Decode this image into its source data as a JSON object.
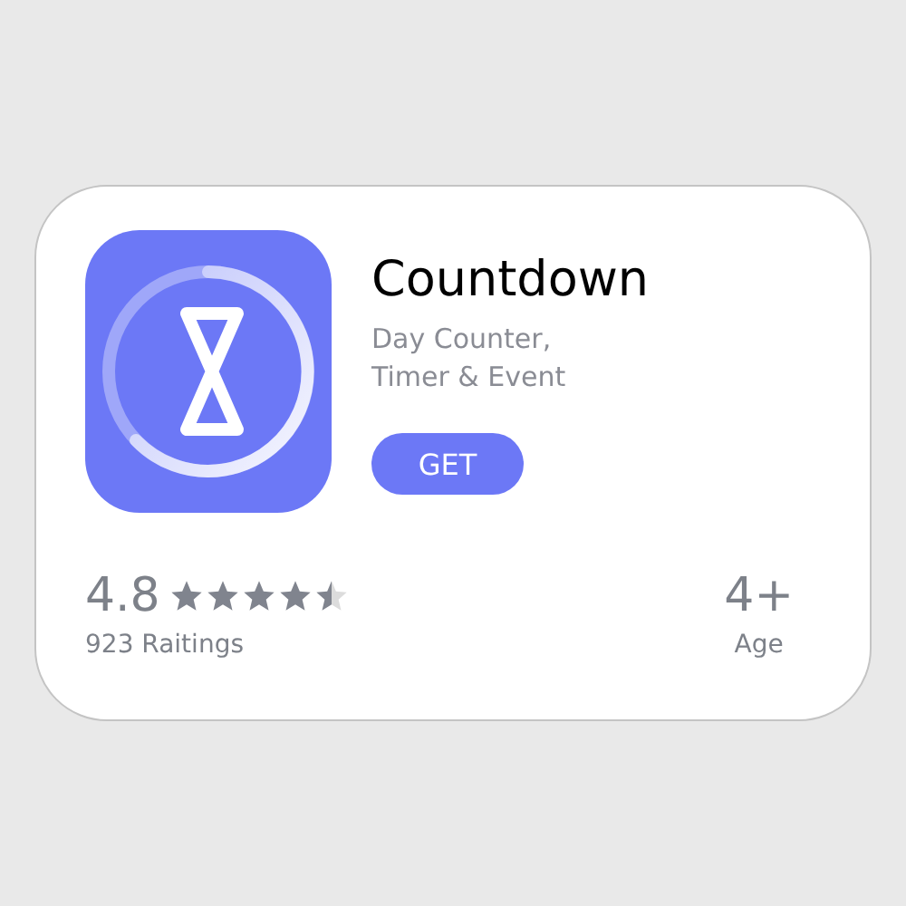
{
  "app": {
    "name": "Countdown",
    "subtitle_lines": [
      "Day Counter,",
      "Timer & Event"
    ],
    "button": "GET"
  },
  "rating": {
    "score": "4.8",
    "stars": 4.5,
    "count": "923 Raitings"
  },
  "age": {
    "value": "4+",
    "label": "Age"
  }
}
